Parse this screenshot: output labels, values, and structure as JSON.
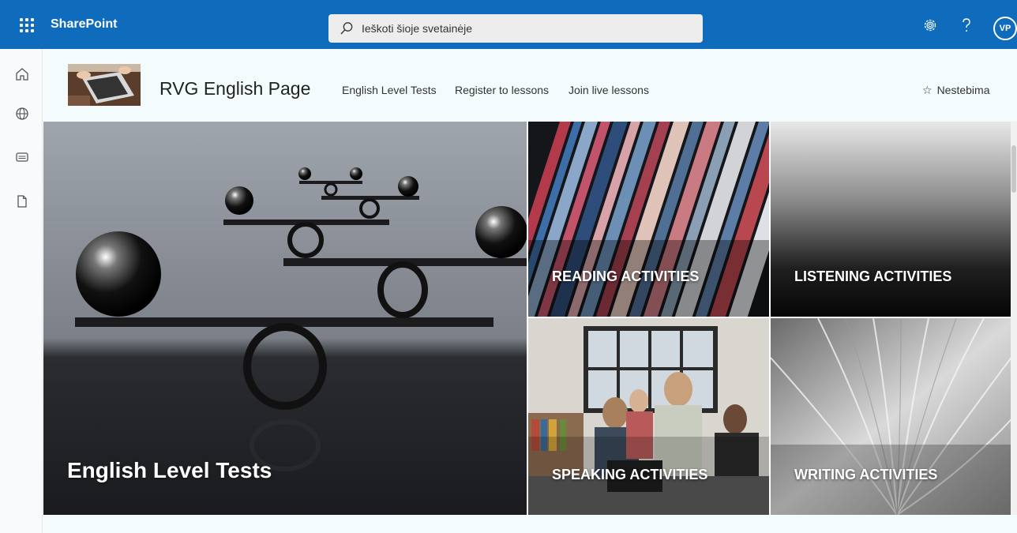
{
  "suite_bar": {
    "brand": "SharePoint",
    "search_placeholder": "Ieškoti šioje svetainėje",
    "avatar_initials": "VP",
    "icons": [
      "waffle-icon",
      "search-icon",
      "gear-icon",
      "help-icon"
    ],
    "color": "#0f6cbd"
  },
  "app_bar": {
    "icons": [
      "home-icon",
      "globe-icon",
      "news-icon",
      "file-icon"
    ]
  },
  "site_header": {
    "title": "RVG English Page",
    "nav": [
      {
        "label": "English Level Tests"
      },
      {
        "label": "Register to lessons"
      },
      {
        "label": "Join live lessons"
      }
    ],
    "follow_label": "Nestebima",
    "follow_icon": "star-icon"
  },
  "hero": {
    "tiles": [
      {
        "label": "English Level Tests"
      },
      {
        "label": "READING ACTIVITIES"
      },
      {
        "label": "LISTENING ACTIVITIES"
      },
      {
        "label": "SPEAKING ACTIVITIES"
      },
      {
        "label": "WRITING ACTIVITIES"
      }
    ]
  }
}
